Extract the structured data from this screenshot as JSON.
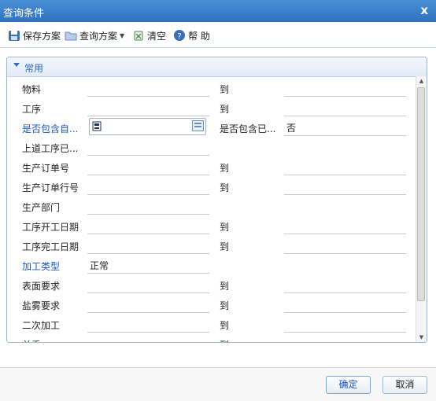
{
  "window": {
    "title": "查询条件",
    "close_glyph": "x"
  },
  "toolbar": {
    "save": "保存方案",
    "query": "查询方案",
    "clear": "清空",
    "help": "帮 助"
  },
  "section": {
    "title": "常用"
  },
  "fields": {
    "material": "物料",
    "process": "工序",
    "include_auto": "是否包含自...",
    "include_auto_value": "",
    "include_done": "是否包含已...",
    "include_done_value": "否",
    "prev_process": "上道工序已...",
    "prod_order": "生产订单号",
    "prod_order_line": "生产订单行号",
    "prod_dept": "生产部门",
    "start_date": "工序开工日期",
    "finish_date": "工序完工日期",
    "proc_type": "加工类型",
    "proc_type_value": "正常",
    "surface": "表面要求",
    "salt_spray": "盐雾要求",
    "secondary": "二次加工",
    "unit_weight": "单重",
    "to": "到"
  },
  "buttons": {
    "ok": "确定",
    "cancel": "取消"
  },
  "colors": {
    "title_bar": "#2f72bf",
    "link_label": "#1a55c4",
    "accent": "#2b6cc4"
  }
}
